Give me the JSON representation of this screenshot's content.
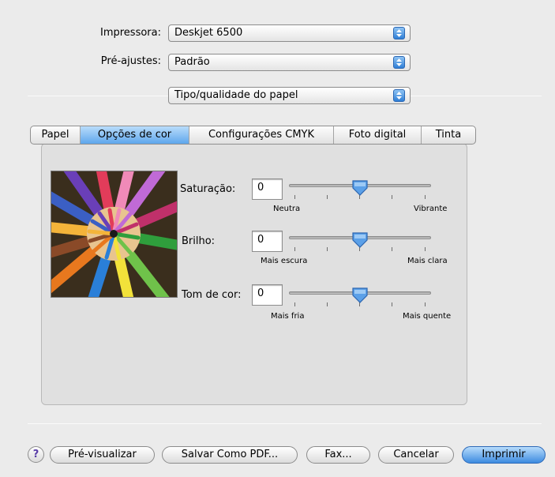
{
  "header": {
    "printer_label": "Impressora:",
    "printer_value": "Deskjet 6500",
    "presets_label": "Pré-ajustes:",
    "presets_value": "Padrão",
    "panel_value": "Tipo/qualidade do papel"
  },
  "tabs": [
    {
      "label": "Papel"
    },
    {
      "label": "Opções de cor"
    },
    {
      "label": "Configurações CMYK"
    },
    {
      "label": "Foto digital"
    },
    {
      "label": "Tinta"
    }
  ],
  "selected_tab": "Opções de cor",
  "sliders": {
    "saturation": {
      "label": "Saturação:",
      "value": "0",
      "min_label": "Neutra",
      "max_label": "Vibrante"
    },
    "brightness": {
      "label": "Brilho:",
      "value": "0",
      "min_label": "Mais escura",
      "max_label": "Mais clara"
    },
    "hue": {
      "label": "Tom de cor:",
      "value": "0",
      "min_label": "Mais fria",
      "max_label": "Mais quente"
    }
  },
  "buttons": {
    "help": "?",
    "preview": "Pré-visualizar",
    "save_pdf": "Salvar Como PDF...",
    "fax": "Fax...",
    "cancel": "Cancelar",
    "print": "Imprimir"
  },
  "colors": {
    "accent": "#5ea6ec",
    "background": "#ebebeb",
    "panel": "#e0e0e0"
  },
  "icons": [
    "popup-arrows-icon",
    "slider-thumb-icon",
    "help-icon",
    "color-pencils-preview"
  ]
}
